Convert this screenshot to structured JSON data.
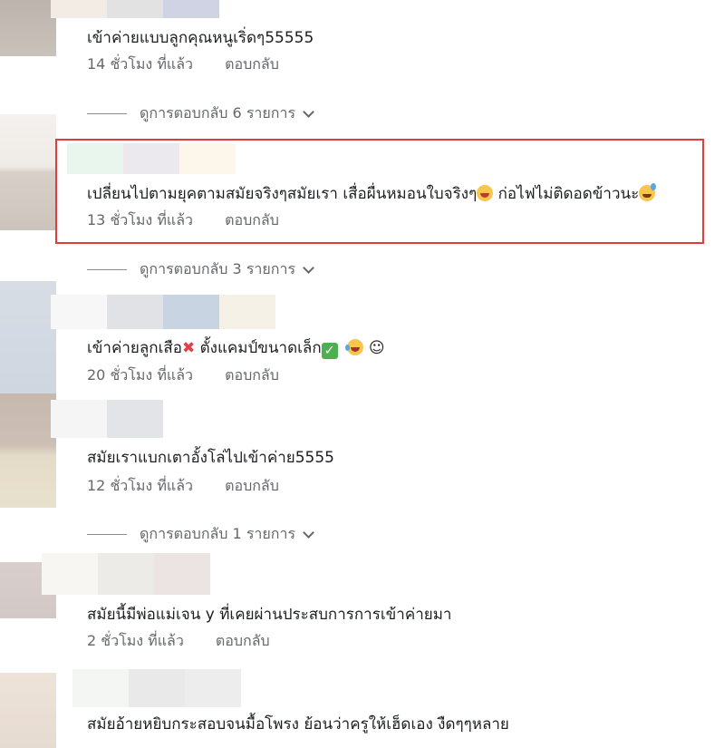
{
  "comments": [
    {
      "text": "เข้าค่ายแบบลูกคุณหนูเริ่ดๆ55555",
      "time": "14 ชั่วโมง ที่แล้ว",
      "reply_label": "ตอบกลับ",
      "view_replies": "ดูการตอบกลับ 6 รายการ"
    },
    {
      "text_a": "เปลี่ยนไปตามยุคตามสมัยจริงๆสมัยเรา เสื่อผื่นหมอนใบจริงๆ",
      "text_b": "ก่อไฟไม่ติดอดข้าวนะ",
      "time": "13 ชั่วโมง ที่แล้ว",
      "reply_label": "ตอบกลับ",
      "view_replies": "ดูการตอบกลับ 3 รายการ",
      "highlighted": true
    },
    {
      "text_a": "เข้าค่ายลูกเสือ",
      "text_b": "ตั้งแคมป์ขนาดเล็ก",
      "cross_glyph": "✖",
      "check_glyph": "✓",
      "smile_glyph": "☺",
      "time": "20 ชั่วโมง ที่แล้ว",
      "reply_label": "ตอบกลับ"
    },
    {
      "text": "สมัยเราแบกเตาอั้งโล่ไปเข้าค่าย5555",
      "time": "12 ชั่วโมง ที่แล้ว",
      "reply_label": "ตอบกลับ",
      "view_replies": "ดูการตอบกลับ 1 รายการ"
    },
    {
      "text": "สมัยนี้มีพ่อแม่เจน y ที่เคยผ่านประสบการการเข้าค่ายมา",
      "time": "2 ชั่วโมง ที่แล้ว",
      "reply_label": "ตอบกลับ"
    },
    {
      "text": "สมัยอ้ายหยิบกระสอบจนมื้อโพรง ย้อนว่าครูให้เฮ็ดเอง งืดๆๆหลาย"
    }
  ],
  "icons": {
    "chevron": "chevron-down-icon",
    "cross": "cross-mark-icon",
    "check": "check-mark-icon",
    "emoji_laugh": "laughing-emoji-icon",
    "emoji_sweat": "grinning-sweat-emoji-icon",
    "emoji_tears": "tears-of-joy-emoji-icon"
  },
  "colors": {
    "highlight_border": "#e03c3c",
    "meta_text": "#65676b",
    "body_text": "#1c1e21"
  }
}
